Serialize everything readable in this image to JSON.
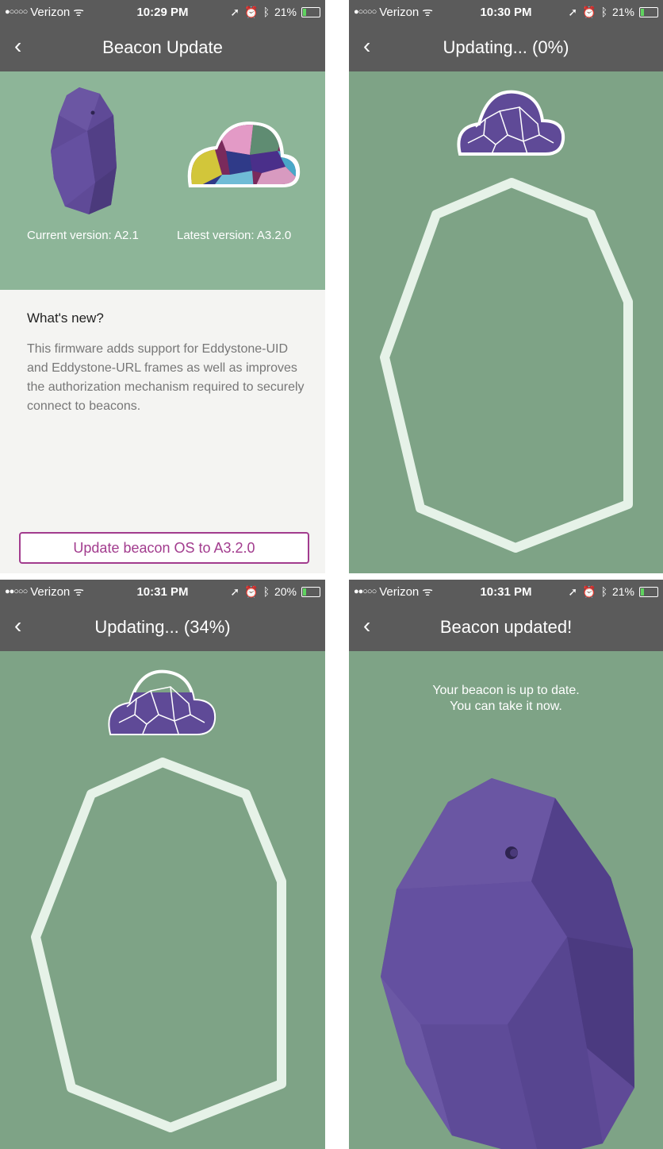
{
  "status_bars": [
    {
      "carrier": "Verizon",
      "time": "10:29 PM",
      "battery": "21%",
      "battery_level": 0.21
    },
    {
      "carrier": "Verizon",
      "time": "10:30 PM",
      "battery": "21%",
      "battery_level": 0.21
    },
    {
      "carrier": "Verizon",
      "time": "10:31 PM",
      "battery": "20%",
      "battery_level": 0.2
    },
    {
      "carrier": "Verizon",
      "time": "10:31 PM",
      "battery": "21%",
      "battery_level": 0.21
    }
  ],
  "screens": {
    "beacon_update": {
      "title": "Beacon Update",
      "back_icon": "chevron-left-icon",
      "current_version": "Current version: A2.1",
      "latest_version": "Latest version: A3.2.0",
      "whats_new_heading": "What's new?",
      "whats_new_body": "This firmware adds support for Eddystone-UID and Eddystone-URL frames as well as improves the authorization mechanism required to securely connect to beacons.",
      "update_button": "Update beacon OS to A3.2.0",
      "accent_color": "#a23c8e"
    },
    "updating_0": {
      "title": "Updating... (0%)",
      "progress": 0
    },
    "updating_34": {
      "title": "Updating... (34%)",
      "progress": 0.34
    },
    "updated": {
      "title": "Beacon updated!",
      "message_line1": "Your beacon is up to date.",
      "message_line2": "You can take it now."
    }
  },
  "colors": {
    "background_green": "#7ea386",
    "hero_green": "#8db598",
    "beacon_purple": "#5f4a97",
    "nav_gray": "#5b5b5b"
  }
}
